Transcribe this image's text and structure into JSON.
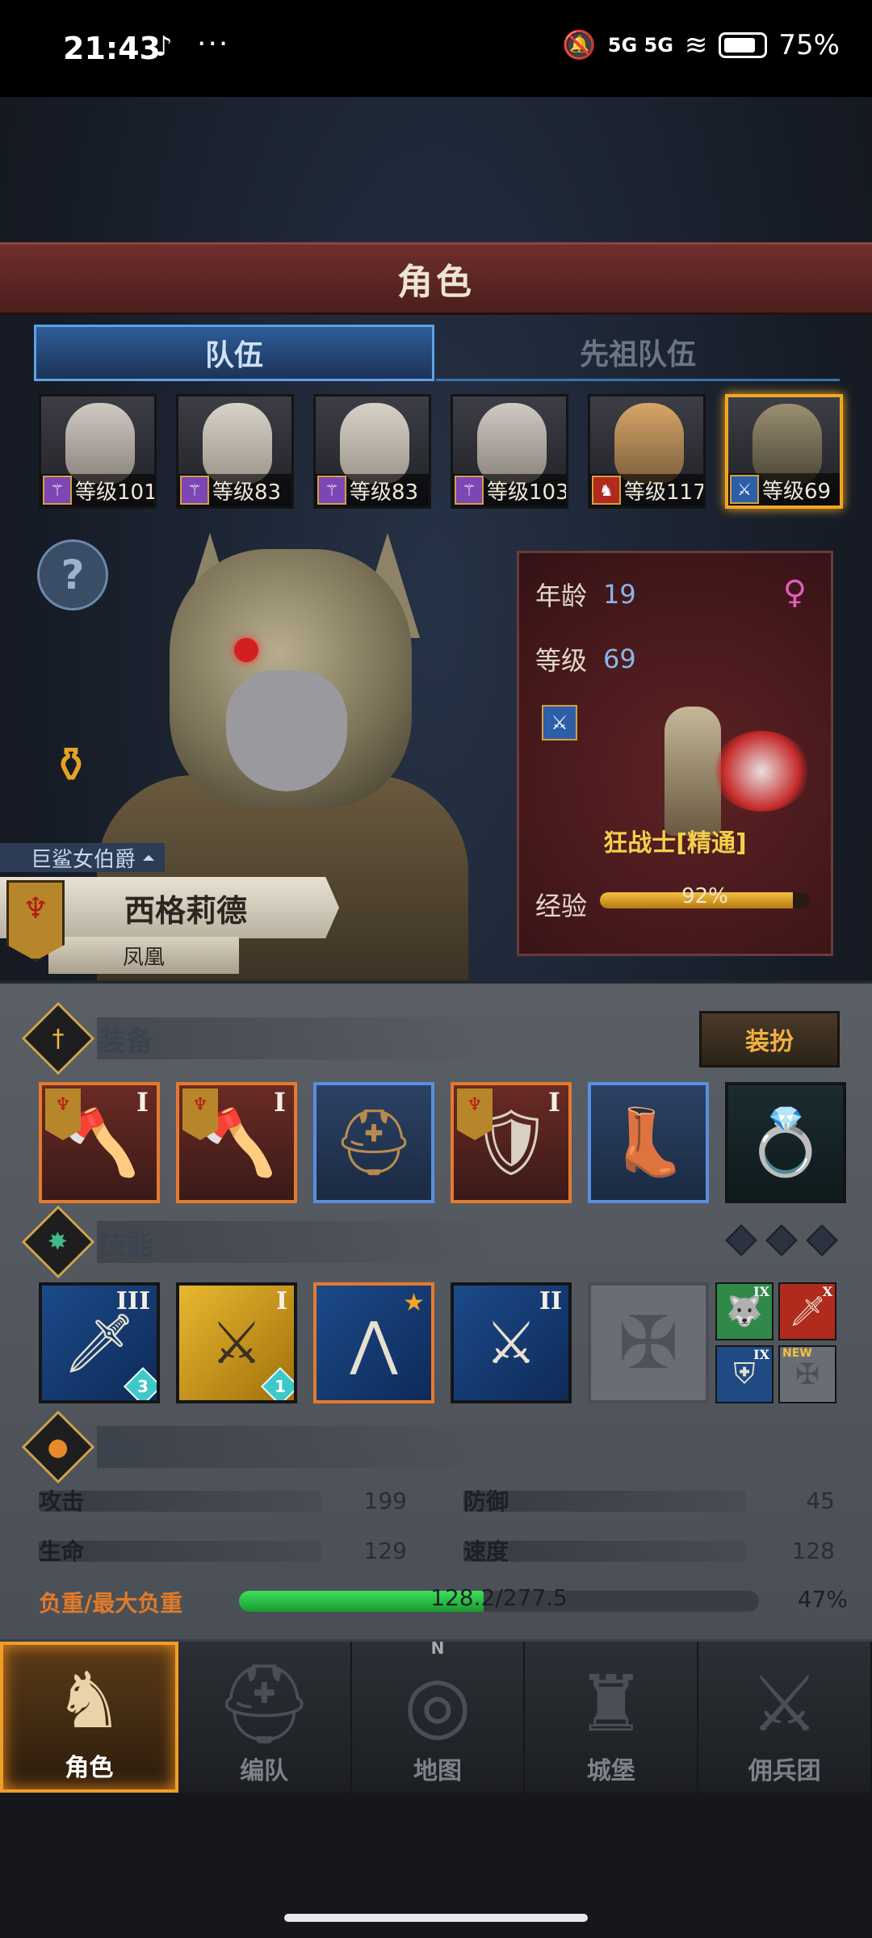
{
  "status_bar": {
    "time": "21:43",
    "network": "5G 5G",
    "battery": "75%",
    "icons": [
      "tiktok-icon",
      "more-dots-icon",
      "mute-icon",
      "signal-icon",
      "wifi-icon",
      "battery-icon"
    ]
  },
  "header": {
    "title": "角色"
  },
  "tabs": [
    {
      "label": "队伍",
      "active": true
    },
    {
      "label": "先祖队伍",
      "active": false
    }
  ],
  "heroes": [
    {
      "level_label": "等级101",
      "class_icon": "staff-icon",
      "selected": false
    },
    {
      "level_label": "等级83",
      "class_icon": "staff-icon",
      "selected": false
    },
    {
      "level_label": "等级83",
      "class_icon": "staff-icon",
      "selected": false
    },
    {
      "level_label": "等级103",
      "class_icon": "staff-icon",
      "selected": false
    },
    {
      "level_label": "等级117",
      "class_icon": "beast-icon",
      "selected": false
    },
    {
      "level_label": "等级69",
      "class_icon": "sword-icon",
      "selected": true
    }
  ],
  "character": {
    "title": "巨鲨女伯爵",
    "name": "西格莉德",
    "sub_name": "凤凰"
  },
  "info": {
    "age_label": "年龄",
    "age_value": "19",
    "level_label": "等级",
    "level_value": "69",
    "class_name": "狂战士[精通]",
    "exp_label": "经验",
    "exp_percent_text": "92%",
    "exp_fraction": 0.92
  },
  "equipment": {
    "section_title": "装备",
    "dress_button": "装扮",
    "slots": [
      {
        "tier": "I",
        "rarity": "orange",
        "icon": "axe-icon"
      },
      {
        "tier": "I",
        "rarity": "orange",
        "icon": "axe-icon"
      },
      {
        "tier": "",
        "rarity": "blue",
        "icon": "helmet-icon"
      },
      {
        "tier": "I",
        "rarity": "orange",
        "icon": "armor-icon"
      },
      {
        "tier": "",
        "rarity": "blue",
        "icon": "boots-icon"
      },
      {
        "tier": "",
        "rarity": "dark",
        "icon": "ring-icon"
      }
    ]
  },
  "skills": {
    "section_title": "技能",
    "slots": [
      {
        "tier": "III",
        "gem": "3",
        "style": "blue",
        "icon": "sword-drop-icon"
      },
      {
        "tier": "I",
        "gem": "1",
        "style": "gold",
        "icon": "claw-icon"
      },
      {
        "tier": "",
        "gem": "",
        "style": "orange",
        "icon": "claw-icon",
        "star": true
      },
      {
        "tier": "II",
        "gem": "",
        "style": "blue",
        "icon": "sword-slash-icon"
      },
      {
        "tier": "",
        "gem": "",
        "style": "empty",
        "icon": "cross-icon"
      }
    ],
    "passives": [
      {
        "tier": "IX",
        "style": "green",
        "icon": "wolf-icon"
      },
      {
        "tier": "X",
        "style": "red",
        "icon": "sword-icon"
      },
      {
        "tier": "IX",
        "style": "blue",
        "icon": "shield-icon"
      },
      {
        "tier": "NEW",
        "style": "empty",
        "icon": "cross-icon"
      }
    ]
  },
  "attributes": {
    "section_title": "属性",
    "attack_label": "攻击",
    "attack_value": "199",
    "defense_label": "防御",
    "defense_value": "45",
    "hp_label": "生命",
    "hp_value": "129",
    "speed_label": "速度",
    "speed_value": "128",
    "load_label": "负重/最大负重",
    "load_text": "128.2/277.5",
    "load_percent_text": "47%",
    "load_fraction": 0.47
  },
  "nav": [
    {
      "label": "角色",
      "icon": "knight-icon",
      "active": true
    },
    {
      "label": "编队",
      "icon": "helm-icon",
      "active": false
    },
    {
      "label": "地图",
      "icon": "compass-icon",
      "active": false
    },
    {
      "label": "城堡",
      "icon": "castle-icon",
      "active": false
    },
    {
      "label": "佣兵团",
      "icon": "mercenary-icon",
      "active": false
    }
  ],
  "colors": {
    "accent_gold": "#f2a623",
    "tab_blue": "#5da2e6",
    "class_yellow": "#f2d04a",
    "load_green": "#3ee05a"
  }
}
